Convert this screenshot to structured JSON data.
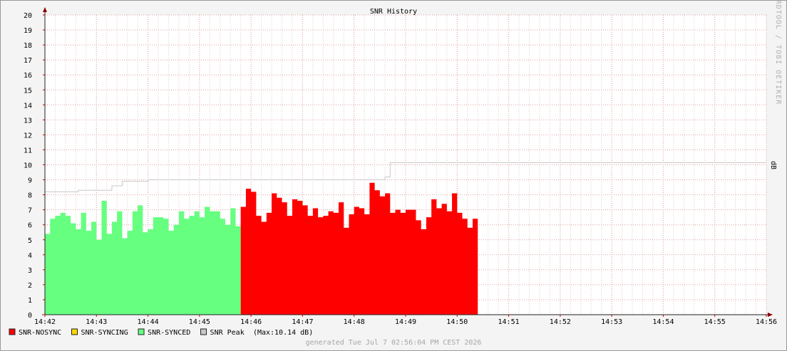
{
  "chart_data": {
    "type": "area",
    "title": "SNR History",
    "ylabel": "dB",
    "watermark": "RRDTOOL / TOBI OETIKER",
    "ylim": [
      0,
      20
    ],
    "y_ticks": [
      "0",
      "1",
      "2",
      "3",
      "4",
      "5",
      "6",
      "7",
      "8",
      "9",
      "10",
      "11",
      "12",
      "13",
      "14",
      "15",
      "16",
      "17",
      "18",
      "19",
      "20"
    ],
    "x_ticks": [
      "14:42",
      "14:43",
      "14:44",
      "14:45",
      "14:46",
      "14:47",
      "14:48",
      "14:49",
      "14:50",
      "14:51",
      "14:52",
      "14:53",
      "14:54",
      "14:55",
      "14:56"
    ],
    "x_range_minutes": [
      0,
      14
    ],
    "grid": true,
    "colors": {
      "nosync": "#ff0000",
      "syncing": "#ffd700",
      "synced": "#66ff80",
      "peak": "#c8c8c8",
      "grid_minor": "#e0a0a0",
      "axis": "#8a0000"
    },
    "series": [
      {
        "name": "SNR-SYNCED",
        "start_minute": 0,
        "step_minutes": 0.1,
        "values": [
          5.4,
          6.4,
          6.6,
          6.8,
          6.6,
          6.1,
          5.7,
          6.8,
          5.6,
          6.2,
          5.0,
          7.6,
          5.4,
          6.2,
          6.9,
          5.1,
          5.6,
          6.9,
          7.3,
          5.5,
          5.7,
          6.5,
          6.5,
          6.4,
          5.6,
          6.0,
          6.9,
          6.4,
          6.6,
          6.9,
          6.5,
          7.2,
          6.9,
          6.9,
          6.4,
          6.0,
          7.1,
          5.9
        ]
      },
      {
        "name": "SNR-NOSYNC",
        "start_minute": 3.8,
        "step_minutes": 0.1,
        "values": [
          7.2,
          8.4,
          8.2,
          6.6,
          6.2,
          6.8,
          8.1,
          7.8,
          7.5,
          6.6,
          7.7,
          7.6,
          7.3,
          6.6,
          7.1,
          6.5,
          6.6,
          6.9,
          6.8,
          7.5,
          5.8,
          6.7,
          7.2,
          7.1,
          6.7,
          8.8,
          8.3,
          7.9,
          8.1,
          6.8,
          7.0,
          6.8,
          7.0,
          7.0,
          6.3,
          5.7,
          6.5,
          7.7,
          7.1,
          7.4,
          6.9,
          8.1,
          6.8,
          6.4,
          5.8,
          6.4
        ]
      }
    ],
    "peak": {
      "name": "SNR Peak",
      "points": [
        [
          0,
          8.2
        ],
        [
          0.65,
          8.3
        ],
        [
          1.3,
          8.6
        ],
        [
          1.5,
          8.9
        ],
        [
          2.0,
          9.0
        ],
        [
          3.7,
          9.0
        ],
        [
          6.4,
          9.0
        ],
        [
          6.6,
          9.2
        ],
        [
          6.7,
          10.14
        ],
        [
          14,
          10.14
        ]
      ]
    },
    "legend": [
      {
        "label": "SNR-NOSYNC",
        "color": "#ff0000"
      },
      {
        "label": "SNR-SYNCING",
        "color": "#ffd700"
      },
      {
        "label": "SNR-SYNCED",
        "color": "#66ff80"
      },
      {
        "label": "SNR Peak",
        "color": "#c8c8c8"
      }
    ],
    "peak_max_label": "(Max:10.14 dB)",
    "footer": "generated Tue Jul  7 02:56:04 PM CEST 2026"
  }
}
